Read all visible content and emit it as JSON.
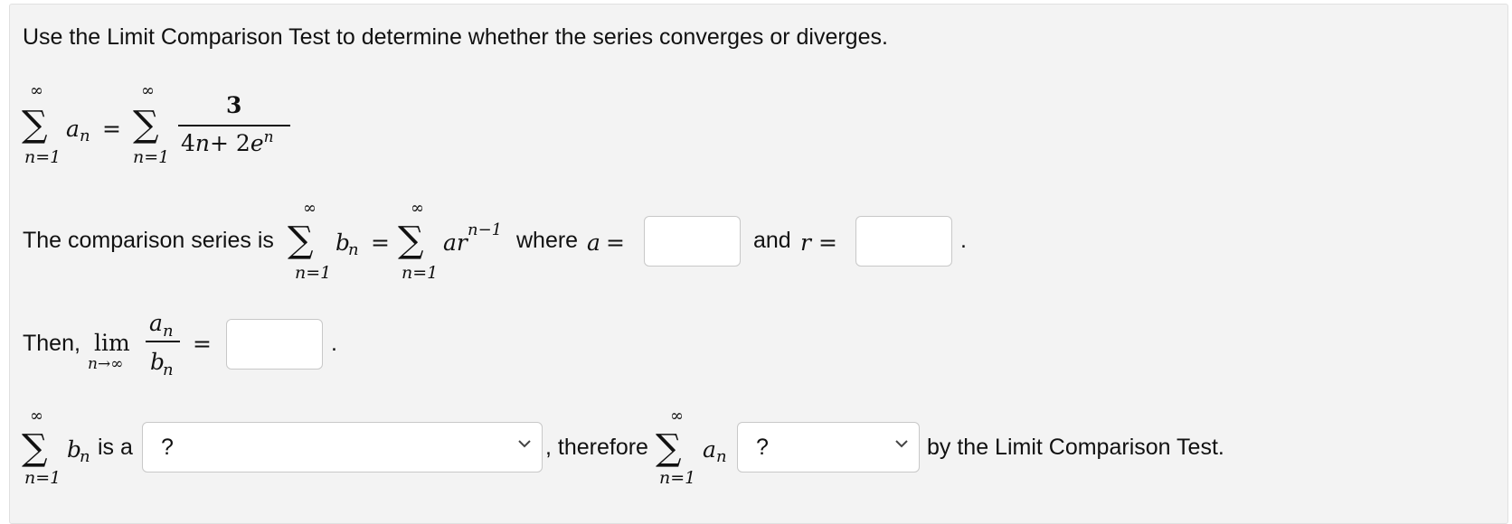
{
  "question": {
    "prompt": "Use the Limit Comparison Test to determine whether the series converges or diverges.",
    "series": {
      "sum_top": "∞",
      "sum_bottom": "n=1",
      "term": "a",
      "term_sub": "n",
      "equals": "=",
      "numerator": "3",
      "denominator_4n": "4",
      "denominator_plus": "+ 2",
      "denominator_e": "e",
      "denominator_exp": "n"
    },
    "comparison": {
      "label": "The comparison series is",
      "b": "b",
      "b_sub": "n",
      "ar": "ar",
      "exponent": "n−1",
      "where_label": "where",
      "a_symbol": "a",
      "and_label": "and",
      "r_symbol": "r",
      "a_value": "",
      "r_value": "",
      "period": "."
    },
    "limit": {
      "then_label": "Then,",
      "lim": "lim",
      "lim_sub": "n→∞",
      "num": "a",
      "num_sub": "n",
      "den": "b",
      "den_sub": "n",
      "value": "",
      "period": "."
    },
    "conclusion": {
      "is_a_label": "is a",
      "select1_value": "?",
      "therefore_label": ", therefore",
      "select2_value": "?",
      "tail_label": "by the Limit Comparison Test."
    }
  }
}
